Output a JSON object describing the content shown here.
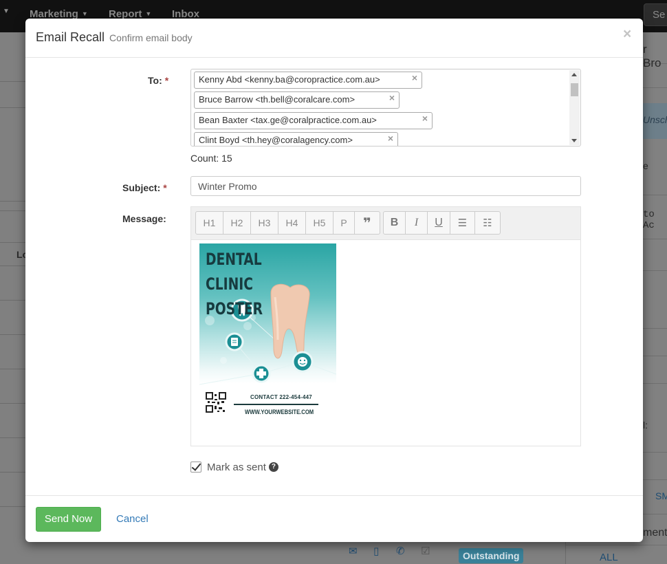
{
  "background": {
    "nav": {
      "marketing": "Marketing",
      "report": "Report",
      "inbox": "Inbox",
      "search_placeholder": "Se"
    },
    "right_fragments": [
      "r Bro",
      "Unsche",
      "e",
      "to Ac",
      "l:",
      "SM",
      "ments",
      "ALL"
    ],
    "left_fragment": "Lo",
    "status_badge": "Outstanding"
  },
  "modal": {
    "title": "Email Recall",
    "subtitle": "Confirm email body",
    "close": "×",
    "to": {
      "label": "To:",
      "required": "*",
      "recipients": [
        "Kenny Abd <kenny.ba@coropractice.com.au>",
        "Bruce Barrow <th.bell@coralcare.com>",
        "Bean Baxter <tax.ge@coralpractice.com.au>",
        "Clint Boyd <th.hey@coralagency.com>"
      ],
      "remove_glyph": "×",
      "count_text": "Count: 15"
    },
    "subject": {
      "label": "Subject:",
      "required": "*",
      "value": "Winter Promo"
    },
    "message": {
      "label": "Message:",
      "toolbar_headings": [
        "H1",
        "H2",
        "H3",
        "H4",
        "H5",
        "P",
        "❞"
      ],
      "toolbar_format": [
        "B",
        "I",
        "U",
        "☰",
        "☷"
      ],
      "poster": {
        "title_line1": "DENTAL CLINIC",
        "title_line2": "POSTER",
        "contact": "CONTACT 222-454-447",
        "website": "WWW.YOURWEBSITE.COM"
      }
    },
    "mark_as_sent": {
      "label": "Mark as sent",
      "checked": true,
      "help": "?"
    },
    "footer": {
      "send": "Send Now",
      "cancel": "Cancel"
    }
  },
  "colors": {
    "primary_green": "#5cb85c",
    "link_blue": "#337ab7",
    "required_red": "#a94442",
    "poster_teal": "#1b8f94"
  }
}
